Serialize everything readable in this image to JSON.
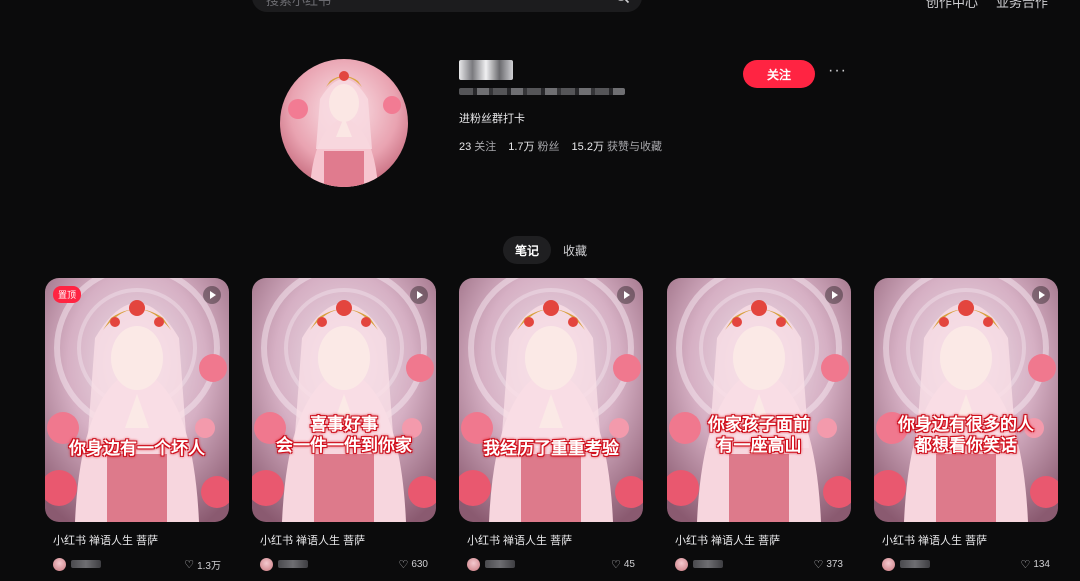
{
  "header": {
    "search_placeholder": "搜索小红书",
    "nav": [
      "创作中心",
      "业务合作"
    ]
  },
  "profile": {
    "bio": "进粉丝群打卡",
    "stats": [
      {
        "value": "23",
        "label": "关注"
      },
      {
        "value": "1.7万",
        "label": "粉丝"
      },
      {
        "value": "15.2万",
        "label": "获赞与收藏"
      }
    ],
    "follow_label": "关注",
    "more_label": "···"
  },
  "tabs": [
    {
      "label": "笔记",
      "active": true
    },
    {
      "label": "收藏",
      "active": false
    }
  ],
  "notes": [
    {
      "caption": [
        "你身边有一个坏人"
      ],
      "title": "小红书 禅语人生 菩萨",
      "likes": "1.3万",
      "pinned": true,
      "pin_label": "置顶"
    },
    {
      "caption": [
        "喜事好事",
        "会一件一件到你家"
      ],
      "title": "小红书 禅语人生 菩萨",
      "likes": "630",
      "pinned": false
    },
    {
      "caption": [
        "我经历了重重考验"
      ],
      "title": "小红书 禅语人生 菩萨",
      "likes": "45",
      "pinned": false
    },
    {
      "caption": [
        "你家孩子面前",
        "有一座高山"
      ],
      "title": "小红书 禅语人生 菩萨",
      "likes": "373",
      "pinned": false
    },
    {
      "caption": [
        "你身边有很多的人",
        "都想看你笑话"
      ],
      "title": "小红书 禅语人生 菩萨",
      "likes": "134",
      "pinned": false
    }
  ],
  "colors": {
    "accent": "#ff2442",
    "background": "#0b0b0c"
  }
}
